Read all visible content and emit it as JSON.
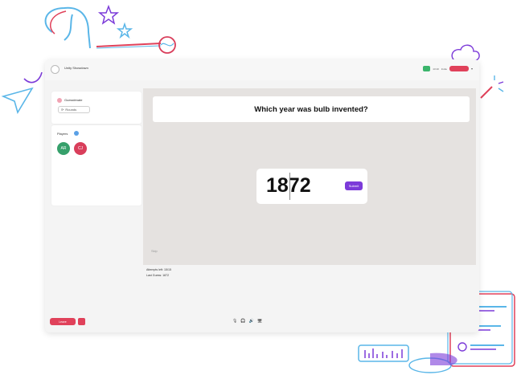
{
  "app": {
    "name": "Unity Showdown",
    "top_text_1": "13:10",
    "top_text_2": "Invite",
    "top_chevron": "▾"
  },
  "sidebar": {
    "mode_label": "Guesstimate",
    "rounds_label": "Rounds",
    "players_label": "Players",
    "players": [
      {
        "initials": "AR",
        "color": "#36a06b"
      },
      {
        "initials": "CJ",
        "color": "#d93e5b"
      }
    ]
  },
  "stage": {
    "question": "Which year was bulb invented?",
    "answer_value": "1872",
    "submit_label": "Submit",
    "footer_text": "Skip"
  },
  "meta": {
    "attempts_left": "Attempts left: 15/15",
    "last_guess": "Last Guess: 1872"
  },
  "bottom": {
    "leave_label": "Leave",
    "icons": [
      "🎙",
      "🎧",
      "🔊",
      "🖥"
    ]
  },
  "colors": {
    "accent_purple": "#7c3bd9",
    "accent_red": "#e0415a",
    "accent_green": "#3bb56c"
  }
}
